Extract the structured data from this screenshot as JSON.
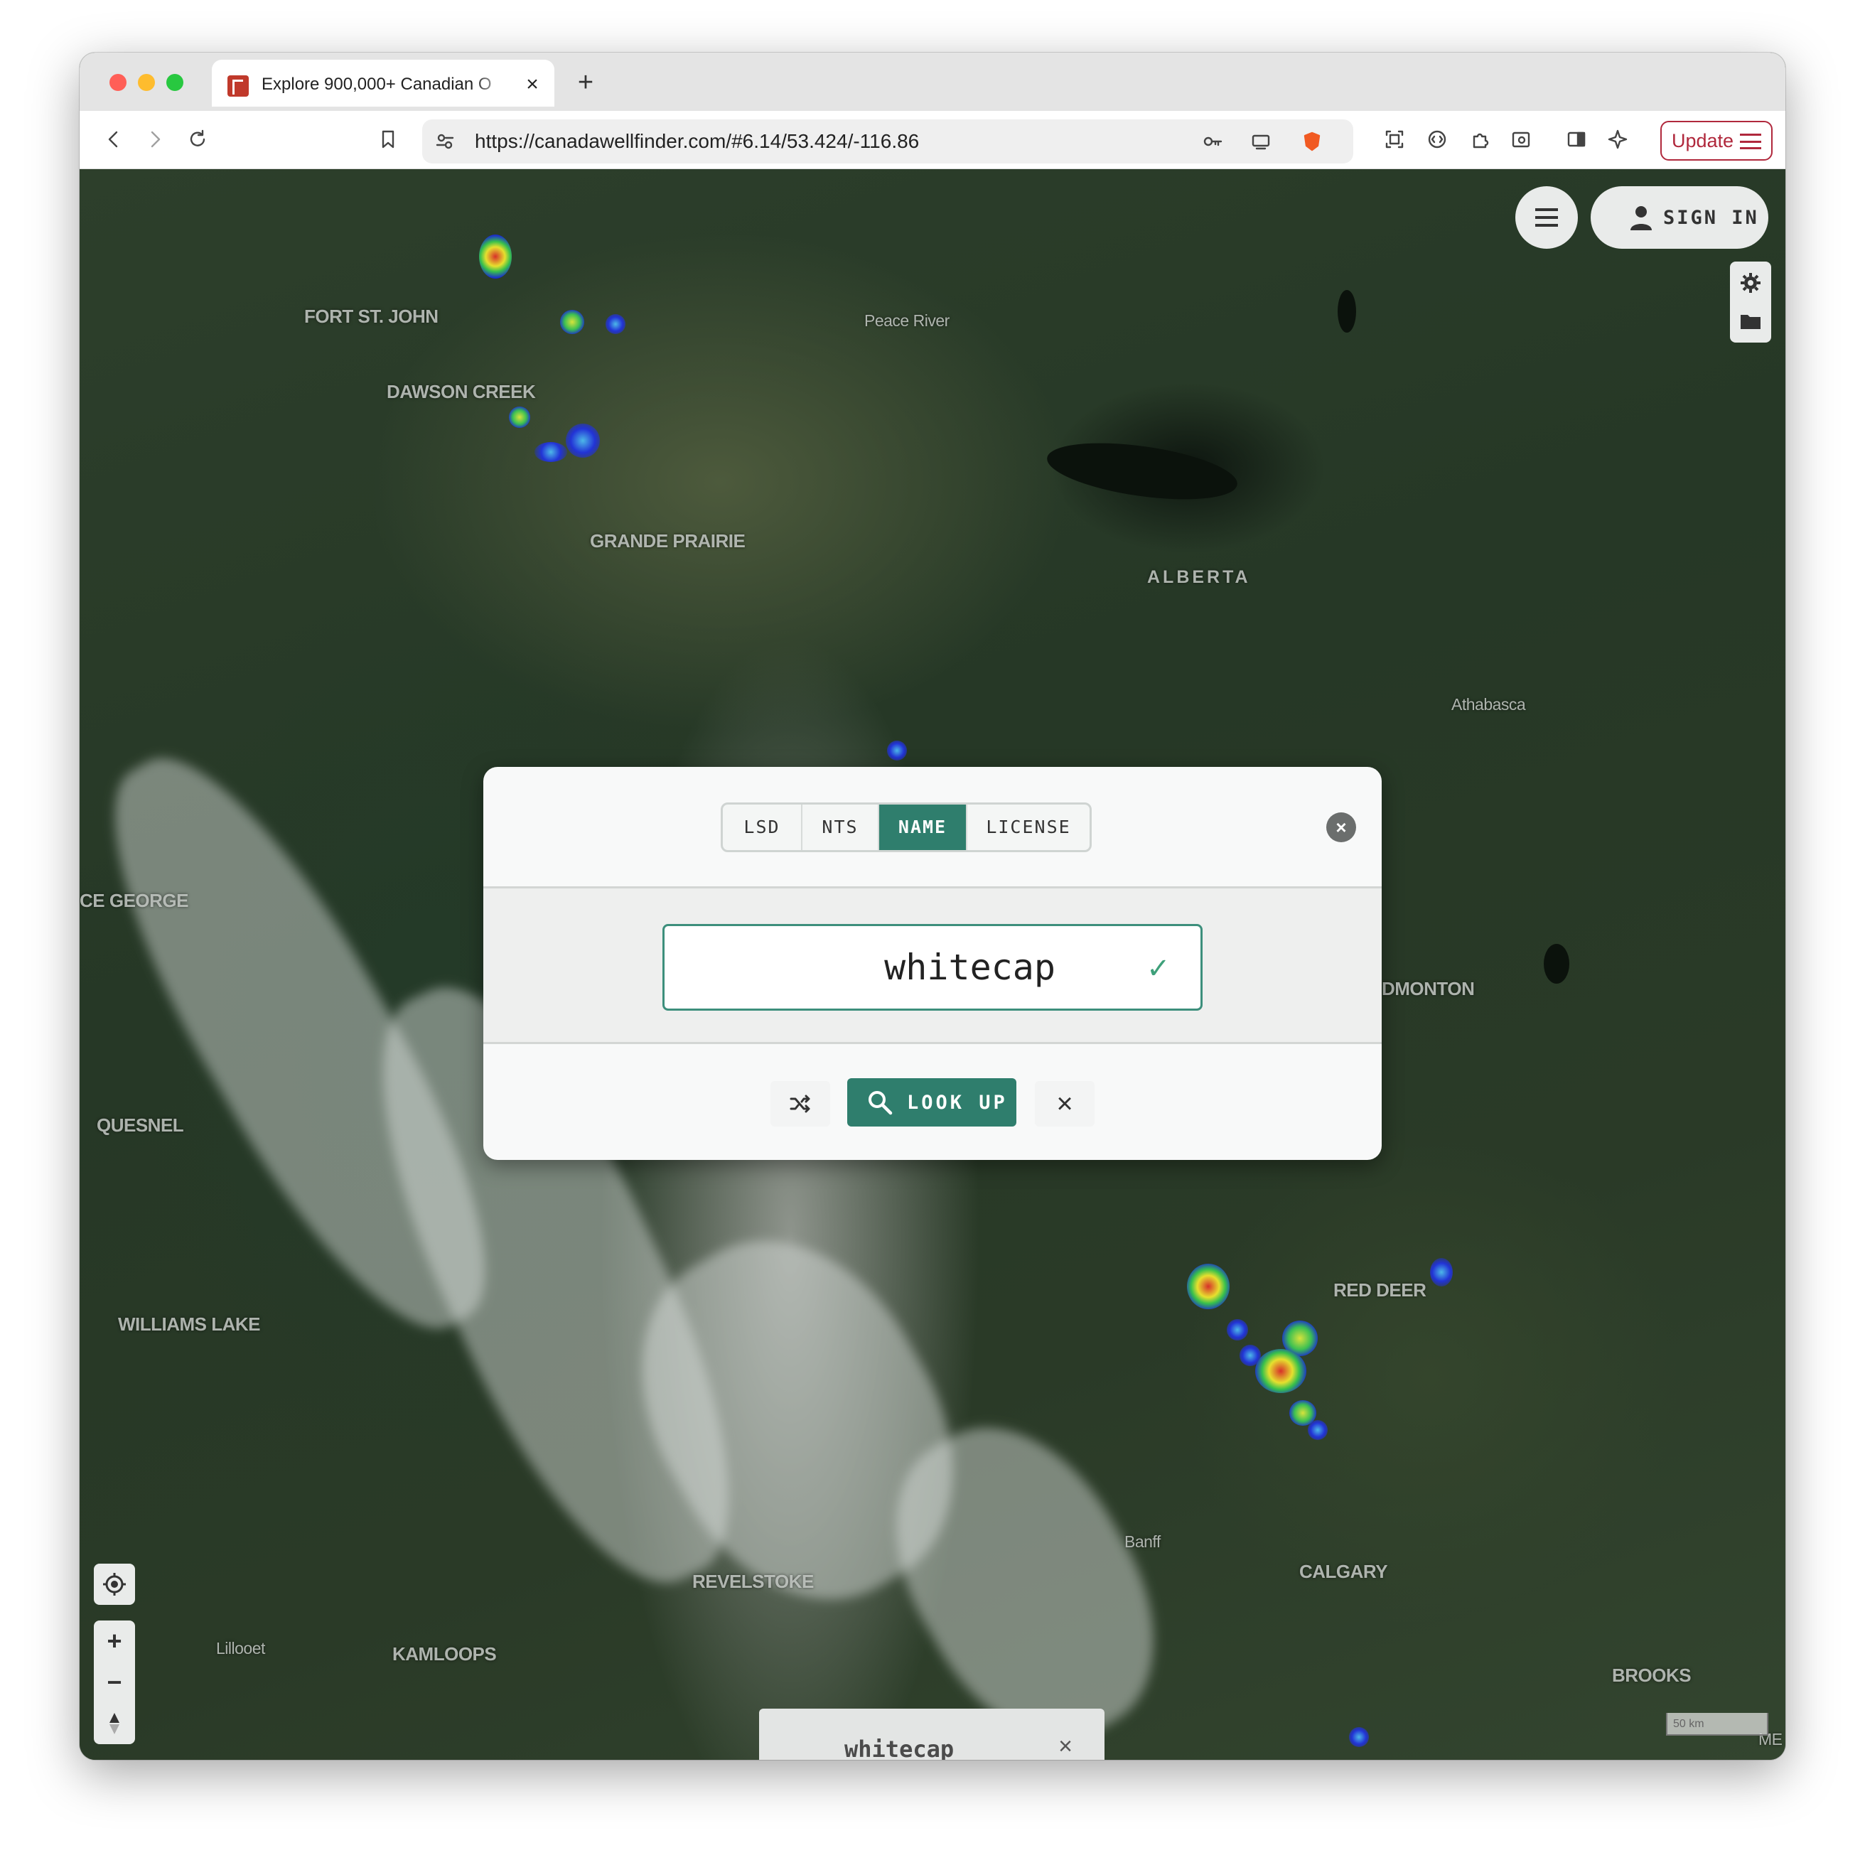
{
  "browser": {
    "tab": {
      "title": "Explore 900,000+ Canadian O",
      "close": "×"
    },
    "new_tab": "+",
    "url": "https://canadawellfinder.com/#6.14/53.424/-116.86",
    "update_label": "Update"
  },
  "map": {
    "labels": {
      "fort_st_john": "FORT ST. JOHN",
      "peace_river": "Peace River",
      "dawson_creek": "DAWSON CREEK",
      "grande_prairie": "GRANDE PRAIRIE",
      "alberta": "ALBERTA",
      "athabasca": "Athabasca",
      "prince_george": "CE GEORGE",
      "edmonton": "DMONTON",
      "quesnel": "QUESNEL",
      "red_deer": "RED DEER",
      "williams_lake": "WILLIAMS LAKE",
      "banff": "Banff",
      "calgary": "CALGARY",
      "revelstoke": "REVELSTOKE",
      "lillooet": "Lillooet",
      "kamloops": "KAMLOOPS",
      "brooks": "BROOKS",
      "medicine_hat": "ME"
    },
    "signin_label": "SIGN IN",
    "scale_label": "50 km",
    "search_chip": {
      "text": "whitecap",
      "close": "×"
    },
    "zoom_in": "+",
    "zoom_out": "−"
  },
  "modal": {
    "tabs": [
      {
        "label": "LSD",
        "active": false
      },
      {
        "label": "NTS",
        "active": false
      },
      {
        "label": "NAME",
        "active": true
      },
      {
        "label": "LICENSE",
        "active": false
      }
    ],
    "input_value": "whitecap",
    "check": "✓",
    "lookup_label": "LOOK UP",
    "clear": "×"
  },
  "colors": {
    "accent": "#2f7e6d",
    "update_red": "#b0283c"
  }
}
